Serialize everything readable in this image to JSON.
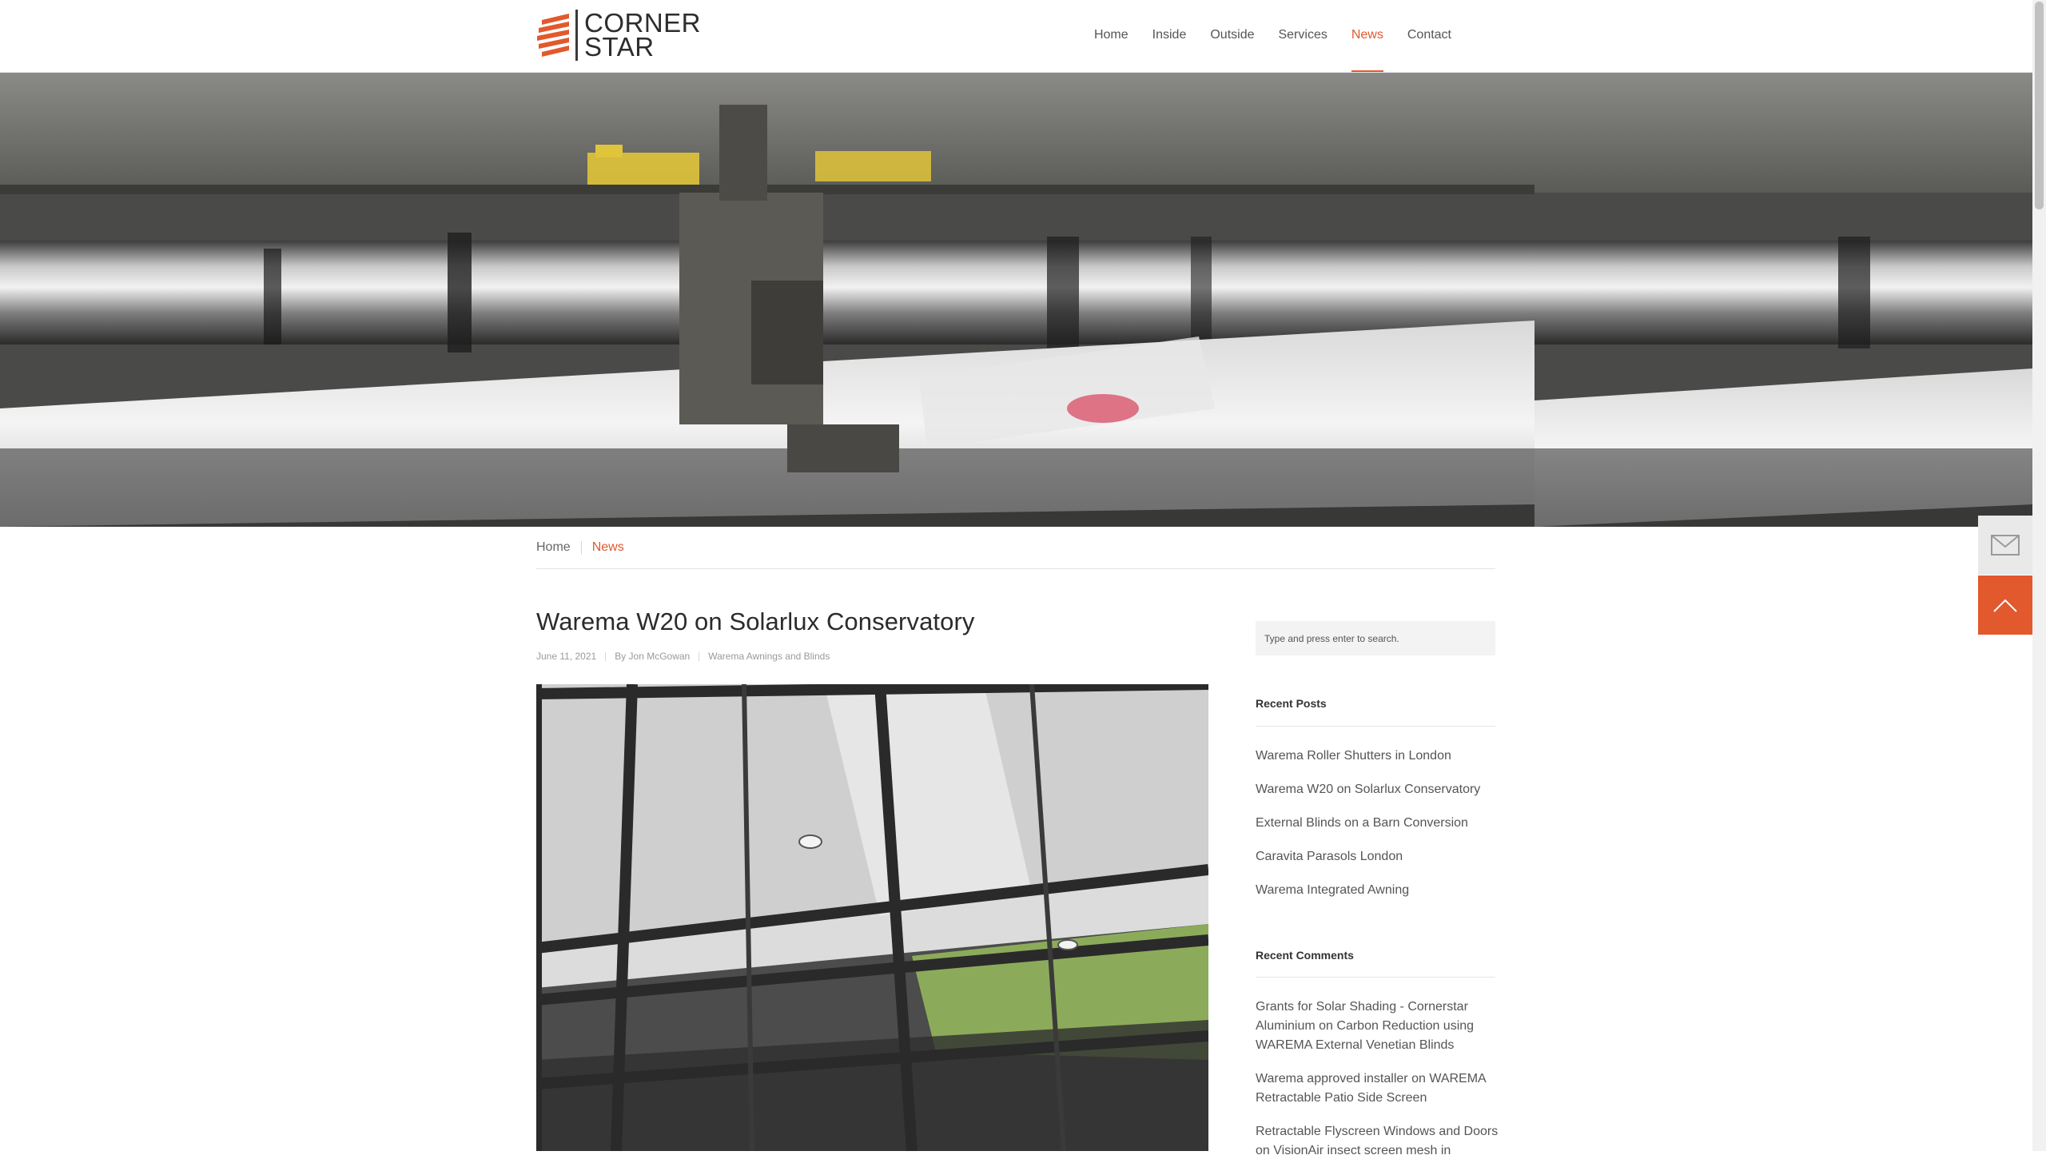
{
  "brand": {
    "logo_line1": "CORNER",
    "logo_line2": "STAR",
    "accent_color": "#e1592d"
  },
  "nav": {
    "items": [
      {
        "label": "Home"
      },
      {
        "label": "Inside"
      },
      {
        "label": "Outside"
      },
      {
        "label": "Services"
      },
      {
        "label": "News",
        "active": true
      },
      {
        "label": "Contact"
      }
    ]
  },
  "breadcrumb": {
    "home": "Home",
    "current": "News"
  },
  "post": {
    "title": "Warema W20 on Solarlux Conservatory",
    "date": "June 11, 2021",
    "author": "By Jon McGowan",
    "category": "Warema Awnings and Blinds"
  },
  "sidebar": {
    "search_placeholder": "Type and press enter to search.",
    "recent_posts_title": "Recent Posts",
    "recent_posts": [
      "Warema Roller Shutters in London",
      "Warema W20 on Solarlux Conservatory",
      "External Blinds on a Barn Conversion",
      "Caravita Parasols London",
      "Warema Integrated Awning"
    ],
    "recent_comments_title": "Recent Comments",
    "recent_comments": [
      {
        "author": "Grants for Solar Shading - Cornerstar Aluminium",
        "on": "on",
        "post": "Carbon Reduction using WAREMA External Venetian Blinds"
      },
      {
        "author": "Warema approved installer",
        "on": "on",
        "post": "WAREMA Retractable Patio Side Screen"
      },
      {
        "author": "Retractable Flyscreen Windows and Doors",
        "on": "on",
        "post": "VisionAir insect screen mesh in"
      }
    ]
  },
  "floating": {
    "mail_icon": "envelope-icon",
    "top_icon": "chevron-up-icon"
  }
}
